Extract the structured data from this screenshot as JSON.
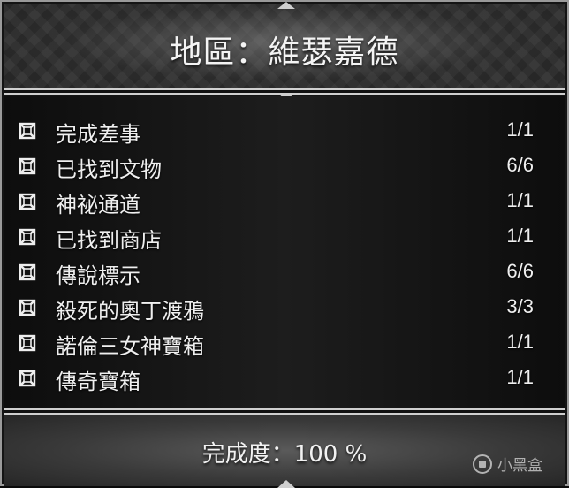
{
  "header": {
    "title": "地區：維瑟嘉德"
  },
  "items": [
    {
      "label": "完成差事",
      "value": "1/1",
      "icon": "knot-icon"
    },
    {
      "label": "已找到文物",
      "value": "6/6",
      "icon": "knot-icon"
    },
    {
      "label": "神祕通道",
      "value": "1/1",
      "icon": "knot-icon"
    },
    {
      "label": "已找到商店",
      "value": "1/1",
      "icon": "knot-icon"
    },
    {
      "label": "傳說標示",
      "value": "6/6",
      "icon": "knot-icon"
    },
    {
      "label": "殺死的奧丁渡鴉",
      "value": "3/3",
      "icon": "knot-icon"
    },
    {
      "label": "諾倫三女神寶箱",
      "value": "1/1",
      "icon": "knot-icon"
    },
    {
      "label": "傳奇寶箱",
      "value": "1/1",
      "icon": "knot-icon"
    }
  ],
  "footer": {
    "completion": "完成度：100 %"
  },
  "watermark": {
    "text": "小黑盒"
  },
  "colors": {
    "text": "#efefef",
    "border": "#cfcfcf",
    "background": "#141414"
  }
}
